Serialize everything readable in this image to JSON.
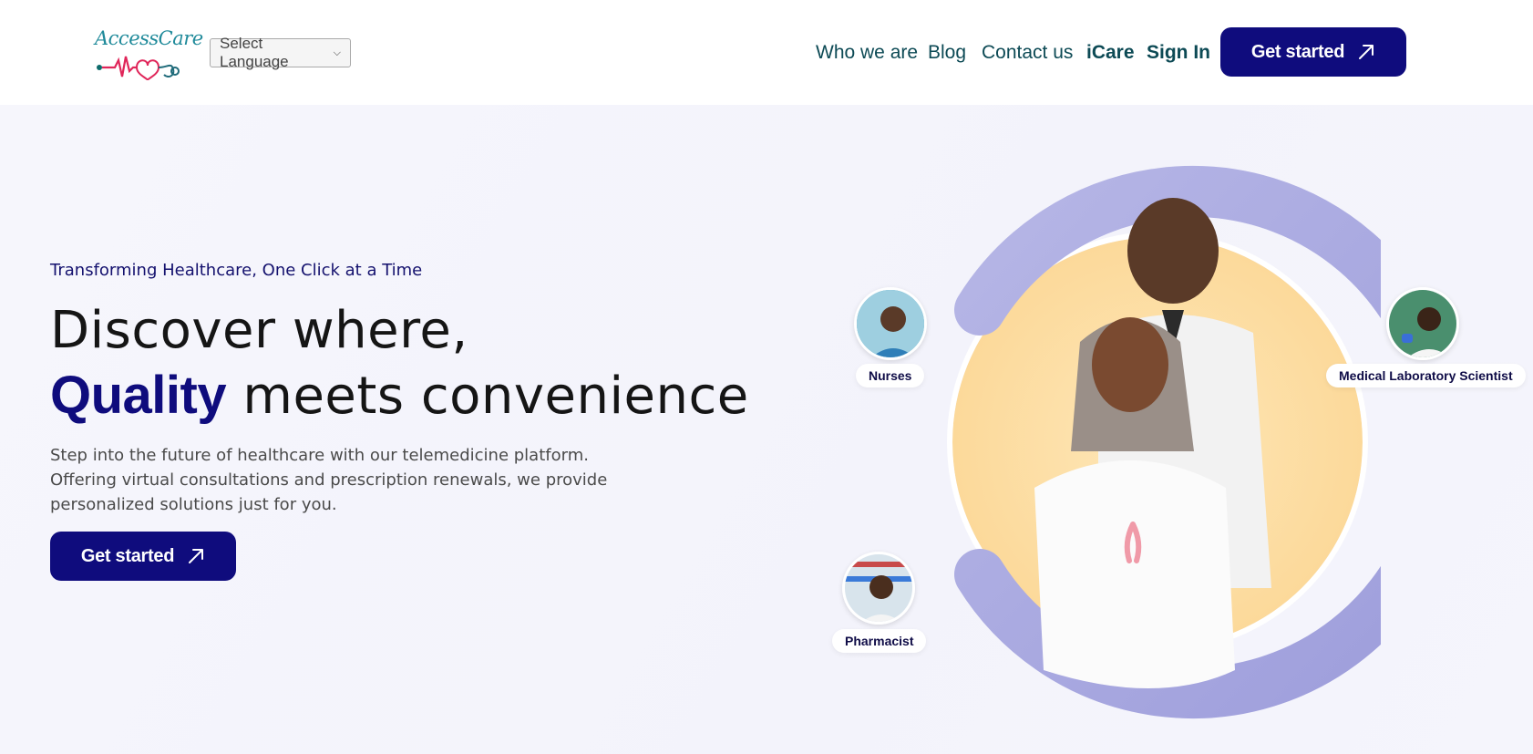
{
  "header": {
    "logo_text": "AccessCare",
    "language_select": {
      "selected": "Select Language"
    },
    "nav": {
      "who_we_are": "Who we are",
      "blog": "Blog",
      "contact_us": "Contact us",
      "icare": "iCare",
      "sign_in": "Sign In"
    },
    "cta_label": "Get started"
  },
  "hero": {
    "tagline": "Transforming Healthcare, One Click at a Time",
    "headline_line1": "Discover where,",
    "headline_accent": "Quality",
    "headline_rest": "meets convenience",
    "description": "Step into the future of healthcare with our telemedicine platform. Offering virtual consultations and prescription renewals, we provide personalized solutions just for you.",
    "cta_label": "Get started"
  },
  "roles": {
    "nurses": "Nurses",
    "lab_scientist": "Medical Laboratory Scientist",
    "pharmacist": "Pharmacist"
  },
  "colors": {
    "brand_navy": "#0f0c7d",
    "nav_text": "#0d4a55",
    "ring_lavender": "#a9a9e0",
    "circle_peach": "#fde0a6"
  },
  "icons": {
    "cta_arrow": "arrow-up-right-icon",
    "select_chevron": "chevron-down-icon"
  }
}
